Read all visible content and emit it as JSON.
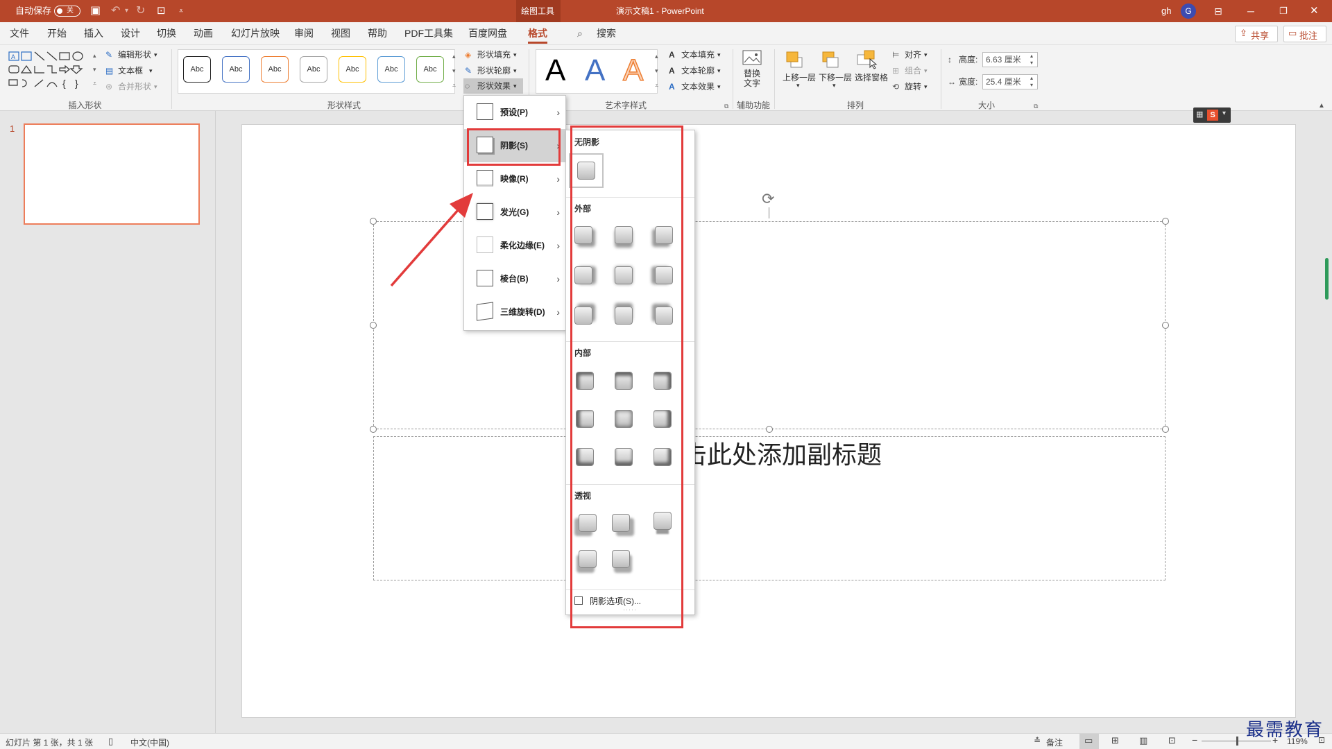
{
  "titlebar": {
    "autosave_label": "自动保存",
    "autosave_state": "关",
    "context_tab": "绘图工具",
    "document_title": "演示文稿1  -  PowerPoint",
    "user_name": "gh",
    "user_initial": "G"
  },
  "menu": {
    "tabs": [
      "文件",
      "开始",
      "插入",
      "设计",
      "切换",
      "动画",
      "幻灯片放映",
      "审阅",
      "视图",
      "帮助",
      "PDF工具集",
      "百度网盘",
      "格式"
    ],
    "active_tab": "格式",
    "search_label": "搜索",
    "share_label": "共享",
    "comment_label": "批注"
  },
  "ribbon": {
    "insert_shapes": {
      "edit_shape": "编辑形状",
      "text_box": "文本框",
      "merge_shapes": "合并形状",
      "group_label": "插入形状"
    },
    "shape_styles": {
      "preset_text": "Abc",
      "preset_colors": [
        "#222222",
        "#4472c4",
        "#ed7d31",
        "#a5a5a5",
        "#ffc000",
        "#5b9bd5",
        "#70ad47"
      ],
      "fill": "形状填充",
      "outline": "形状轮廓",
      "effects": "形状效果",
      "group_label": "形状样式"
    },
    "wordart": {
      "letter": "A",
      "text_fill": "文本填充",
      "text_outline": "文本轮廓",
      "text_effects": "文本效果",
      "group_label": "艺术字样式"
    },
    "accessibility": {
      "alt_text": "替换文字",
      "group_label": "辅助功能"
    },
    "arrange": {
      "bring_forward": "上移一层",
      "send_backward": "下移一层",
      "selection_pane": "选择窗格",
      "align": "对齐",
      "group": "组合",
      "rotate": "旋转",
      "group_label": "排列"
    },
    "size": {
      "height_label": "高度:",
      "height_value": "6.63 厘米",
      "width_label": "宽度:",
      "width_value": "25.4 厘米",
      "group_label": "大小"
    }
  },
  "thumbnails": [
    {
      "number": "1"
    }
  ],
  "slide": {
    "subtitle_placeholder": "单击此处添加副标题"
  },
  "effects_menu": {
    "items": [
      {
        "label": "预设(P)"
      },
      {
        "label": "阴影(S)"
      },
      {
        "label": "映像(R)"
      },
      {
        "label": "发光(G)"
      },
      {
        "label": "柔化边缘(E)"
      },
      {
        "label": "棱台(B)"
      },
      {
        "label": "三维旋转(D)"
      }
    ],
    "highlighted": "阴影(S)"
  },
  "shadow_gallery": {
    "no_shadow_label": "无阴影",
    "outer_label": "外部",
    "inner_label": "内部",
    "perspective_label": "透视",
    "options_label": "阴影选项(S)..."
  },
  "statusbar": {
    "slide_info": "幻灯片 第 1 张，共 1 张",
    "language": "中文(中国)",
    "notes": "备注",
    "zoom": "119%"
  },
  "watermark": {
    "text": "最需教育"
  },
  "colors": {
    "accent": "#b7472a",
    "annotation_red": "#e23b3b"
  }
}
